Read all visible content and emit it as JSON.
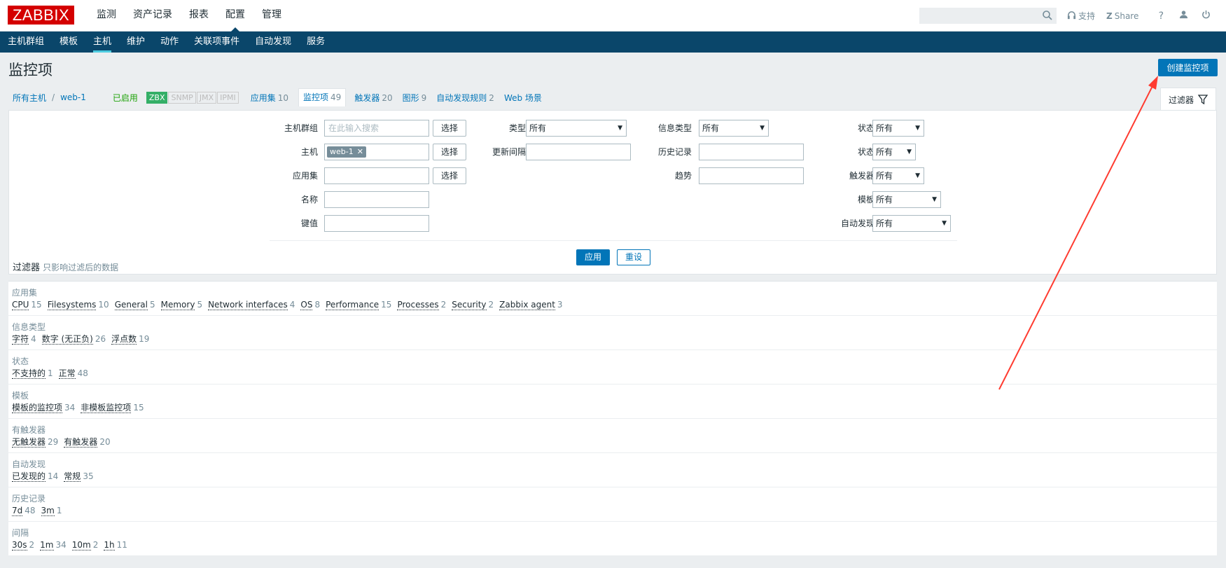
{
  "logo": "ZABBIX",
  "main_menu": [
    "监测",
    "资产记录",
    "报表",
    "配置",
    "管理"
  ],
  "top_links": {
    "support": "支持",
    "share": "Share",
    "help": "?"
  },
  "sub_menu": [
    "主机群组",
    "模板",
    "主机",
    "维护",
    "动作",
    "关联项事件",
    "自动发现",
    "服务"
  ],
  "page_title": "监控项",
  "create_button": "创建监控项",
  "breadcrumb": {
    "all_hosts": "所有主机",
    "separator": "/",
    "host": "web-1",
    "status": "已启用"
  },
  "availability": [
    "ZBX",
    "SNMP",
    "JMX",
    "IPMI"
  ],
  "host_tabs": [
    {
      "label": "应用集",
      "count": "10"
    },
    {
      "label": "监控项",
      "count": "49"
    },
    {
      "label": "触发器",
      "count": "20"
    },
    {
      "label": "图形",
      "count": "9"
    },
    {
      "label": "自动发现规则",
      "count": "2"
    },
    {
      "label": "Web 场景",
      "count": ""
    }
  ],
  "filter_tab": "过滤器",
  "filter": {
    "host_groups_label": "主机群组",
    "host_groups_placeholder": "在此输入搜索",
    "select": "选择",
    "host_label": "主机",
    "host_tag": "web-1",
    "applications_label": "应用集",
    "name_label": "名称",
    "key_label": "键值",
    "type_label": "类型",
    "type_value": "所有",
    "update_interval_label": "更新间隔",
    "info_type_label": "信息类型",
    "info_type_value": "所有",
    "history_label": "历史记录",
    "trends_label": "趋势",
    "state_label": "状态",
    "state_value": "所有",
    "status_label": "状态",
    "status_value": "所有",
    "triggers_label": "触发器",
    "triggers_value": "所有",
    "template_label": "模板",
    "template_value": "所有",
    "discovery_label": "自动发现",
    "discovery_value": "所有",
    "apply": "应用",
    "reset": "重设"
  },
  "subfilter_note": {
    "title": "过滤器",
    "desc": "只影响过滤后的数据"
  },
  "subfilters": [
    {
      "title": "应用集",
      "items": [
        {
          "name": "CPU",
          "count": "15"
        },
        {
          "name": "Filesystems",
          "count": "10"
        },
        {
          "name": "General",
          "count": "5"
        },
        {
          "name": "Memory",
          "count": "5"
        },
        {
          "name": "Network interfaces",
          "count": "4"
        },
        {
          "name": "OS",
          "count": "8"
        },
        {
          "name": "Performance",
          "count": "15"
        },
        {
          "name": "Processes",
          "count": "2"
        },
        {
          "name": "Security",
          "count": "2"
        },
        {
          "name": "Zabbix agent",
          "count": "3"
        }
      ]
    },
    {
      "title": "信息类型",
      "items": [
        {
          "name": "字符",
          "count": "4"
        },
        {
          "name": "数字 (无正负)",
          "count": "26"
        },
        {
          "name": "浮点数",
          "count": "19"
        }
      ]
    },
    {
      "title": "状态",
      "items": [
        {
          "name": "不支持的",
          "count": "1"
        },
        {
          "name": "正常",
          "count": "48"
        }
      ]
    },
    {
      "title": "模板",
      "items": [
        {
          "name": "模板的监控项",
          "count": "34"
        },
        {
          "name": "非模板监控项",
          "count": "15"
        }
      ]
    },
    {
      "title": "有触发器",
      "items": [
        {
          "name": "无触发器",
          "count": "29"
        },
        {
          "name": "有触发器",
          "count": "20"
        }
      ]
    },
    {
      "title": "自动发现",
      "items": [
        {
          "name": "已发现的",
          "count": "14"
        },
        {
          "name": "常规",
          "count": "35"
        }
      ]
    },
    {
      "title": "历史记录",
      "items": [
        {
          "name": "7d",
          "count": "48"
        },
        {
          "name": "3m",
          "count": "1"
        }
      ]
    },
    {
      "title": "间隔",
      "items": [
        {
          "name": "30s",
          "count": "2"
        },
        {
          "name": "1m",
          "count": "34"
        },
        {
          "name": "10m",
          "count": "2"
        },
        {
          "name": "1h",
          "count": "11"
        }
      ]
    }
  ],
  "colors": {
    "brand": "#d40000",
    "nav": "#0a466a",
    "accent": "#0275b8",
    "enabled": "#1fa30a",
    "zbx": "#34af67",
    "annotation": "#ff3b30"
  },
  "icons": [
    "search-icon",
    "headset-icon",
    "share-icon",
    "help-icon",
    "user-icon",
    "power-icon",
    "filter-icon"
  ]
}
